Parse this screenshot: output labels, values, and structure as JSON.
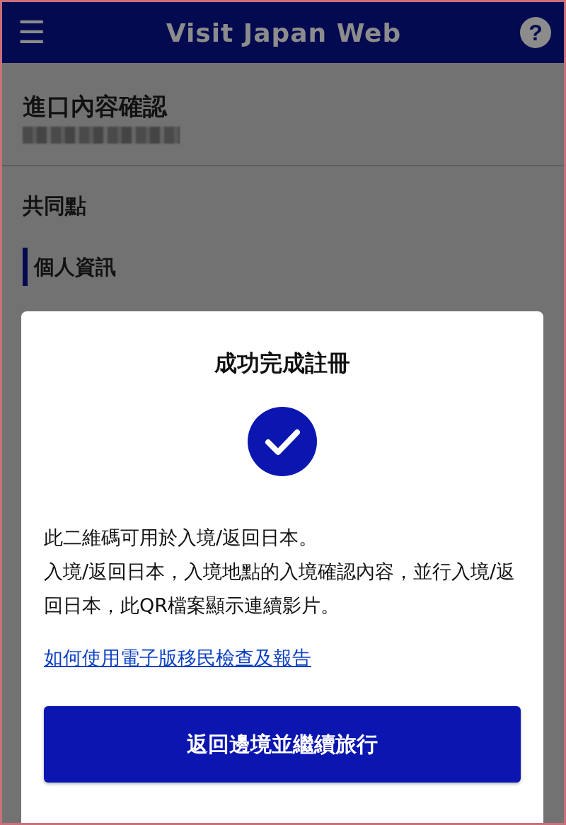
{
  "header": {
    "menu_icon": "☰",
    "title": "Visit Japan Web",
    "help_icon": "?"
  },
  "page": {
    "title": "進口內容確認",
    "section": "共同點",
    "subsection": "個人資訊"
  },
  "dialog": {
    "title": "成功完成註冊",
    "paragraphs": [
      "此二維碼可用於入境/返回日本。",
      "入境/返回日本，入境地點的入境確認內容，並行入境/返回日本，此QR檔案顯示連續影片。"
    ],
    "link": "如何使用電子版移民檢查及報告",
    "button": "返回邊境並繼續旅行"
  }
}
